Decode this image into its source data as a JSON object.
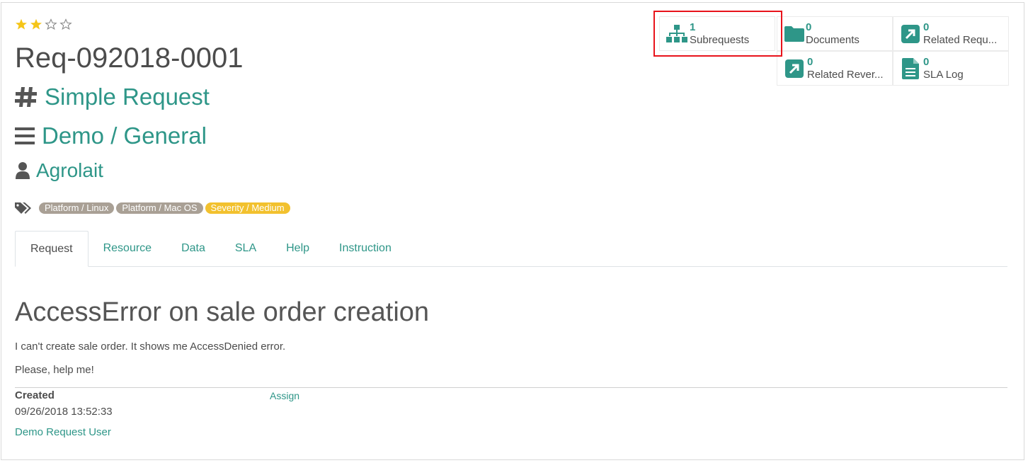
{
  "priority": {
    "stars_filled": 2,
    "stars_total": 4
  },
  "request": {
    "name": "Req-092018-0001",
    "type": "Simple Request",
    "category": "Demo / General",
    "partner": "Agrolait"
  },
  "tags": [
    {
      "label": "Platform / Linux",
      "color": "#a9a095"
    },
    {
      "label": "Platform / Mac OS",
      "color": "#a9a095"
    },
    {
      "label": "Severity / Medium",
      "color": "#f2c12e"
    }
  ],
  "smart_buttons": {
    "subrequests": {
      "value": "1",
      "label": "Subrequests"
    },
    "documents": {
      "value": "0",
      "label": "Documents"
    },
    "related_requests": {
      "value": "0",
      "label": "Related Requ..."
    },
    "related_reverse": {
      "value": "0",
      "label": "Related Rever..."
    },
    "sla_log": {
      "value": "0",
      "label": "SLA Log"
    }
  },
  "tabs": [
    "Request",
    "Resource",
    "Data",
    "SLA",
    "Help",
    "Instruction"
  ],
  "body": {
    "title": "AccessError on sale order creation",
    "line1": "I can't create sale order. It shows me AccessDenied error.",
    "line2": "Please, help me!"
  },
  "footer": {
    "created_label": "Created",
    "created_date": "09/26/2018 13:52:33",
    "created_user": "Demo Request User",
    "assign_label": "Assign"
  },
  "colors": {
    "accent": "#2e9688",
    "star": "#f5c518",
    "highlight": "#e8131b"
  }
}
